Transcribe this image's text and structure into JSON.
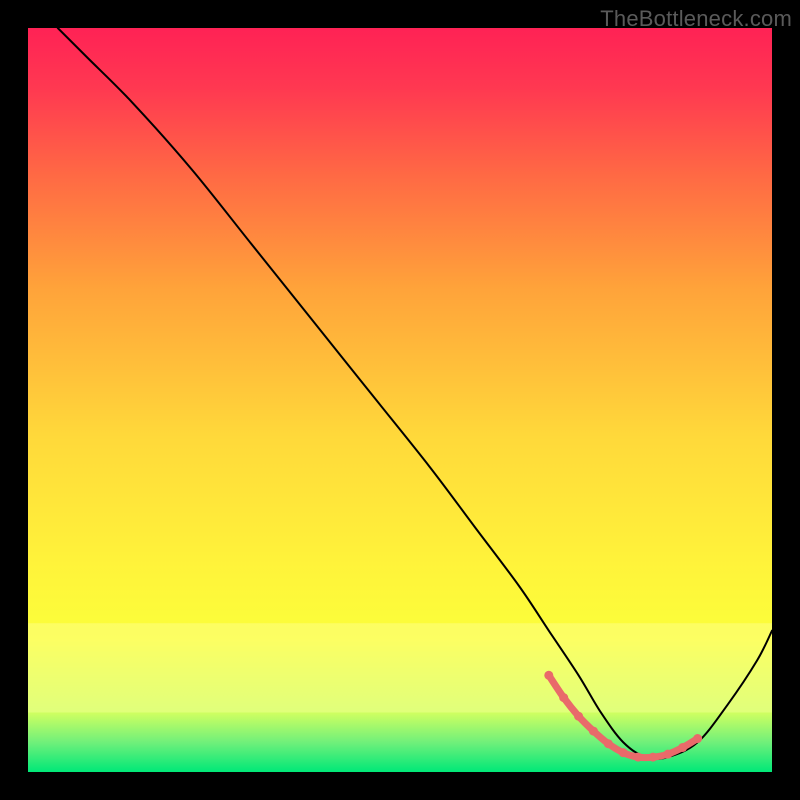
{
  "attribution": "TheBottleneck.com",
  "chart_data": {
    "type": "line",
    "title": "",
    "xlabel": "",
    "ylabel": "",
    "xlim": [
      0,
      100
    ],
    "ylim": [
      0,
      100
    ],
    "grid": false,
    "gradient_stops": [
      {
        "offset": 0.0,
        "color": "#ff2255"
      },
      {
        "offset": 0.08,
        "color": "#ff3851"
      },
      {
        "offset": 0.2,
        "color": "#ff6a44"
      },
      {
        "offset": 0.35,
        "color": "#ffa33a"
      },
      {
        "offset": 0.55,
        "color": "#ffd93a"
      },
      {
        "offset": 0.72,
        "color": "#fff33a"
      },
      {
        "offset": 0.82,
        "color": "#fbff3a"
      },
      {
        "offset": 0.92,
        "color": "#d0ff60"
      },
      {
        "offset": 0.96,
        "color": "#70f07a"
      },
      {
        "offset": 1.0,
        "color": "#00e878"
      }
    ],
    "series": [
      {
        "name": "bottleneck-curve",
        "color": "#000000",
        "width": 2.0,
        "x": [
          4,
          8,
          14,
          22,
          30,
          38,
          46,
          54,
          60,
          66,
          70,
          74,
          77,
          80,
          83,
          86,
          90,
          94,
          98,
          100
        ],
        "y": [
          100,
          96,
          90,
          81,
          71,
          61,
          51,
          41,
          33,
          25,
          19,
          13,
          8,
          4,
          2,
          2,
          4,
          9,
          15,
          19
        ]
      }
    ],
    "highlight": {
      "name": "optimal-zone",
      "color": "#e96a6a",
      "marker_radius": 4.5,
      "line_width": 7,
      "x": [
        70,
        72,
        74,
        76,
        78,
        80,
        82,
        84,
        86,
        88,
        90
      ],
      "y": [
        13.0,
        10.0,
        7.5,
        5.5,
        3.8,
        2.6,
        2.0,
        2.0,
        2.4,
        3.3,
        4.5
      ]
    }
  }
}
